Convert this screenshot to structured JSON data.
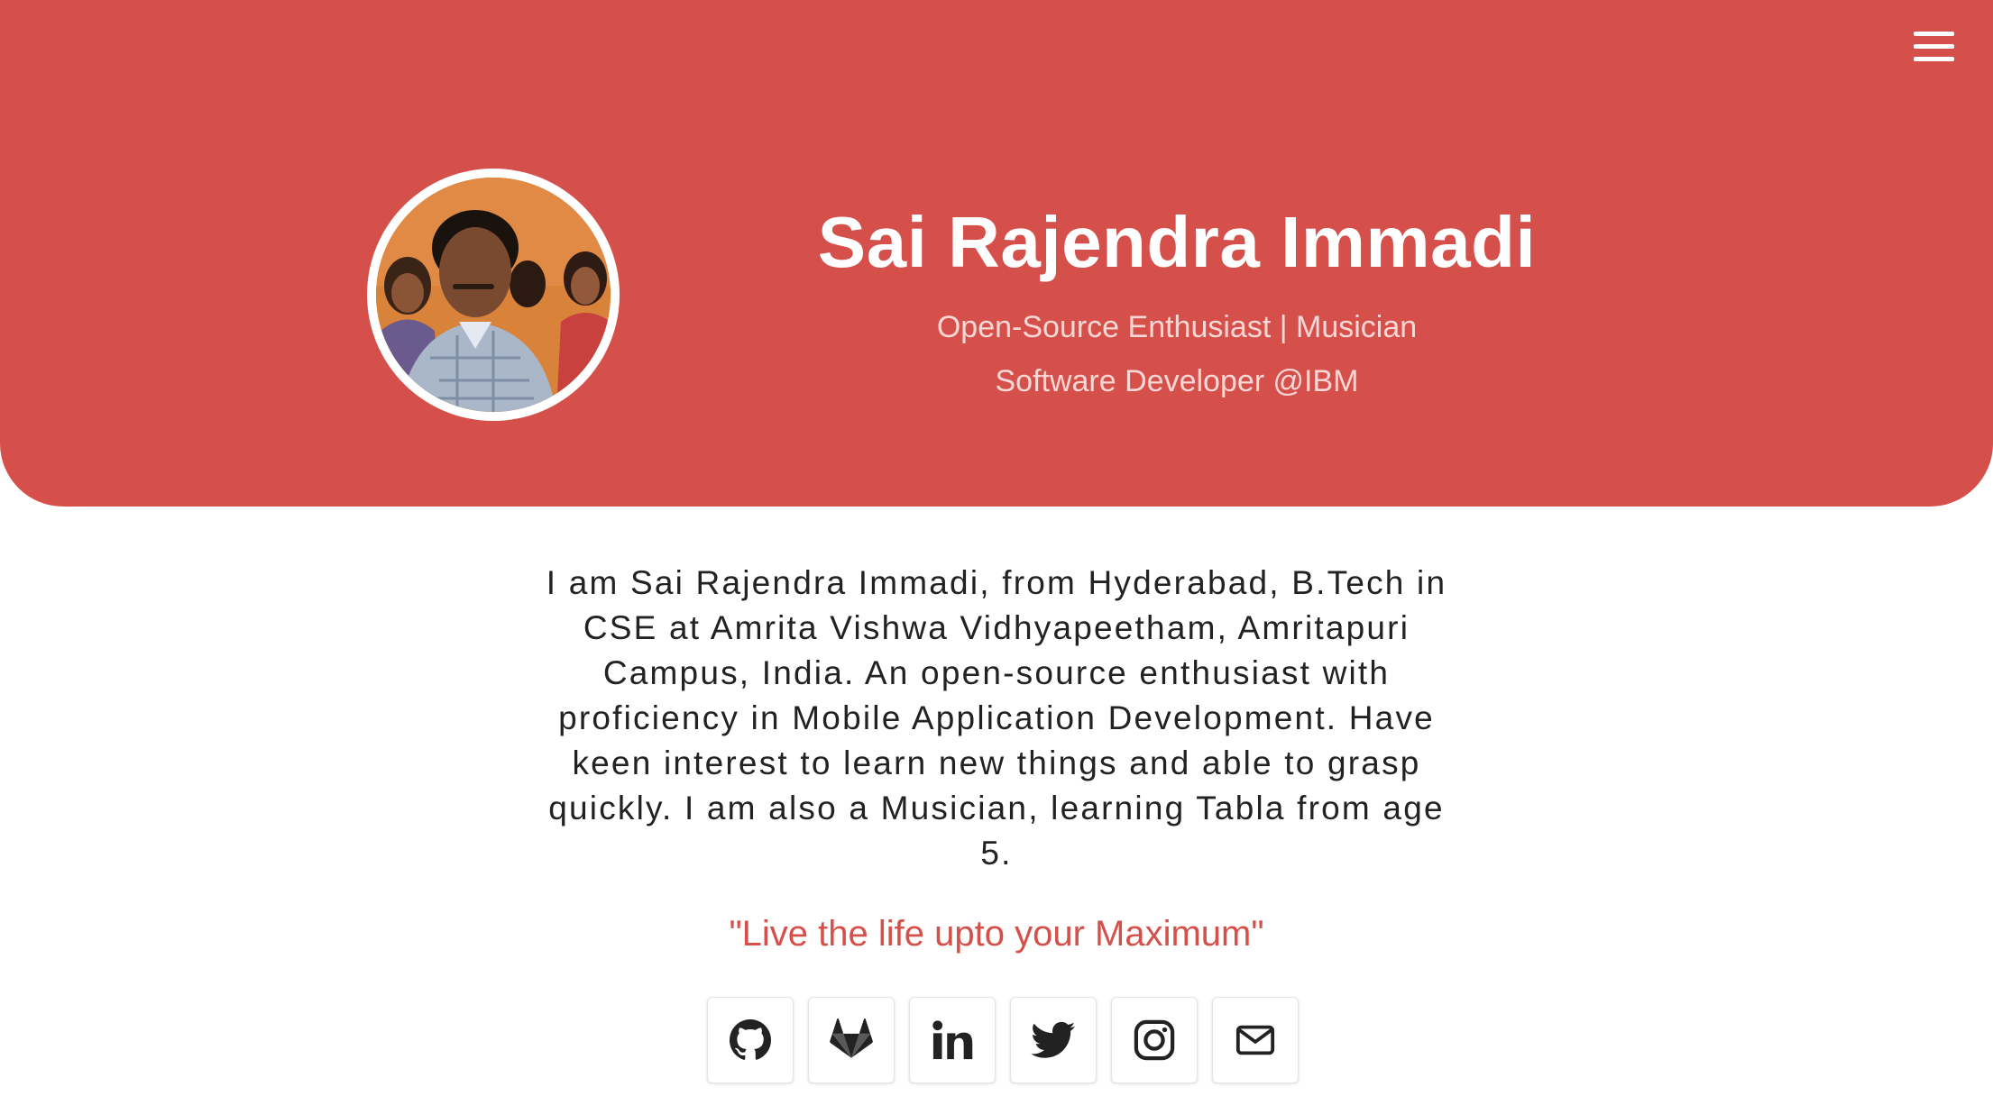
{
  "theme": {
    "accent": "#d5504b"
  },
  "header": {
    "menu_icon": "hamburger-menu-icon",
    "avatar": "profile-photo",
    "name": "Sai Rajendra Immadi",
    "tagline_1": "Open-Source Enthusiast | Musician",
    "tagline_2": "Software Developer @IBM"
  },
  "about": {
    "bio": "I am Sai Rajendra Immadi, from Hyderabad, B.Tech in CSE at Amrita Vishwa Vidhyapeetham, Amritapuri Campus, India. An open-source enthusiast with proficiency in Mobile Application Development. Have keen interest to learn new things and able to grasp quickly. I am also a Musician, learning Tabla from age 5.",
    "quote": "\"Live the life upto your Maximum\""
  },
  "social_links": [
    {
      "icon": "github-icon"
    },
    {
      "icon": "gitlab-icon"
    },
    {
      "icon": "linkedin-icon"
    },
    {
      "icon": "twitter-icon"
    },
    {
      "icon": "instagram-icon"
    },
    {
      "icon": "mail-icon"
    }
  ]
}
